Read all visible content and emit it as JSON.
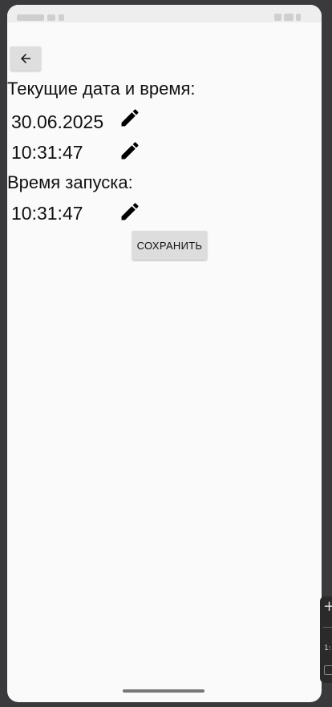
{
  "status_bar": {
    "time": "10:31"
  },
  "back_button": {
    "icon": "arrow-left-icon"
  },
  "current_datetime": {
    "label": "Текущие дата и время:",
    "date": "30.06.2025",
    "time": "10:31:47",
    "edit_icon": "pencil-icon"
  },
  "launch_time": {
    "label": "Время запуска:",
    "time": "10:31:47",
    "edit_icon": "pencil-icon"
  },
  "save_button": {
    "label": "СОХРАНИТЬ"
  },
  "side_toolbar": {
    "plus": "+",
    "text": "1:"
  },
  "colors": {
    "background": "#fafafa",
    "button": "#dddddd",
    "text": "#111111"
  }
}
